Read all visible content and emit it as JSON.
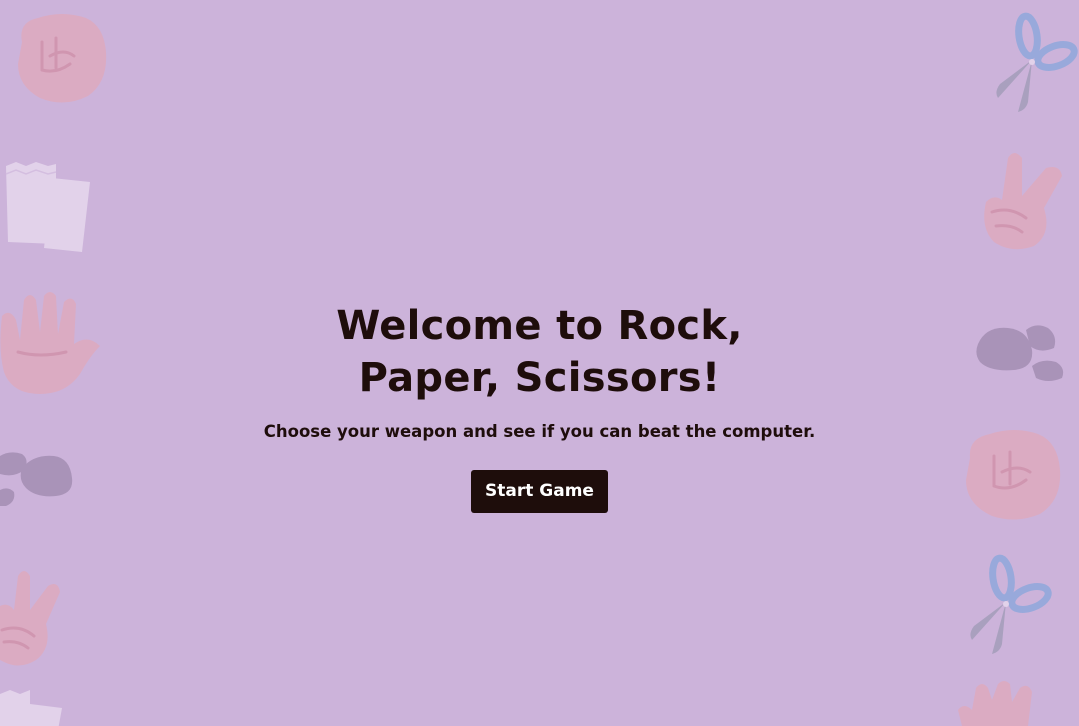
{
  "welcome": {
    "title_line1": "Welcome to Rock,",
    "title_line2": "Paper, Scissors!",
    "subtitle": "Choose your weapon and see if you can beat the computer.",
    "start_label": "Start Game"
  },
  "decorations": {
    "left": [
      "fist-icon",
      "paper-icon",
      "open-hand-icon",
      "rocks-icon",
      "peace-hand-icon",
      "paper-icon"
    ],
    "right": [
      "scissors-icon",
      "peace-hand-icon",
      "rocks-icon",
      "fist-icon",
      "scissors-icon",
      "open-hand-icon"
    ]
  },
  "colors": {
    "background": "#ccb3da",
    "text": "#1e0d0b",
    "button_bg": "#1e0d0b",
    "button_text": "#ffffff",
    "hand": "#e8b0b8",
    "hand_line": "#d98a95",
    "paper": "#e6d8ef",
    "rock": "#9e8aa8",
    "scissors_blade": "#8e92a8",
    "scissors_handle": "#6ea2dc"
  }
}
